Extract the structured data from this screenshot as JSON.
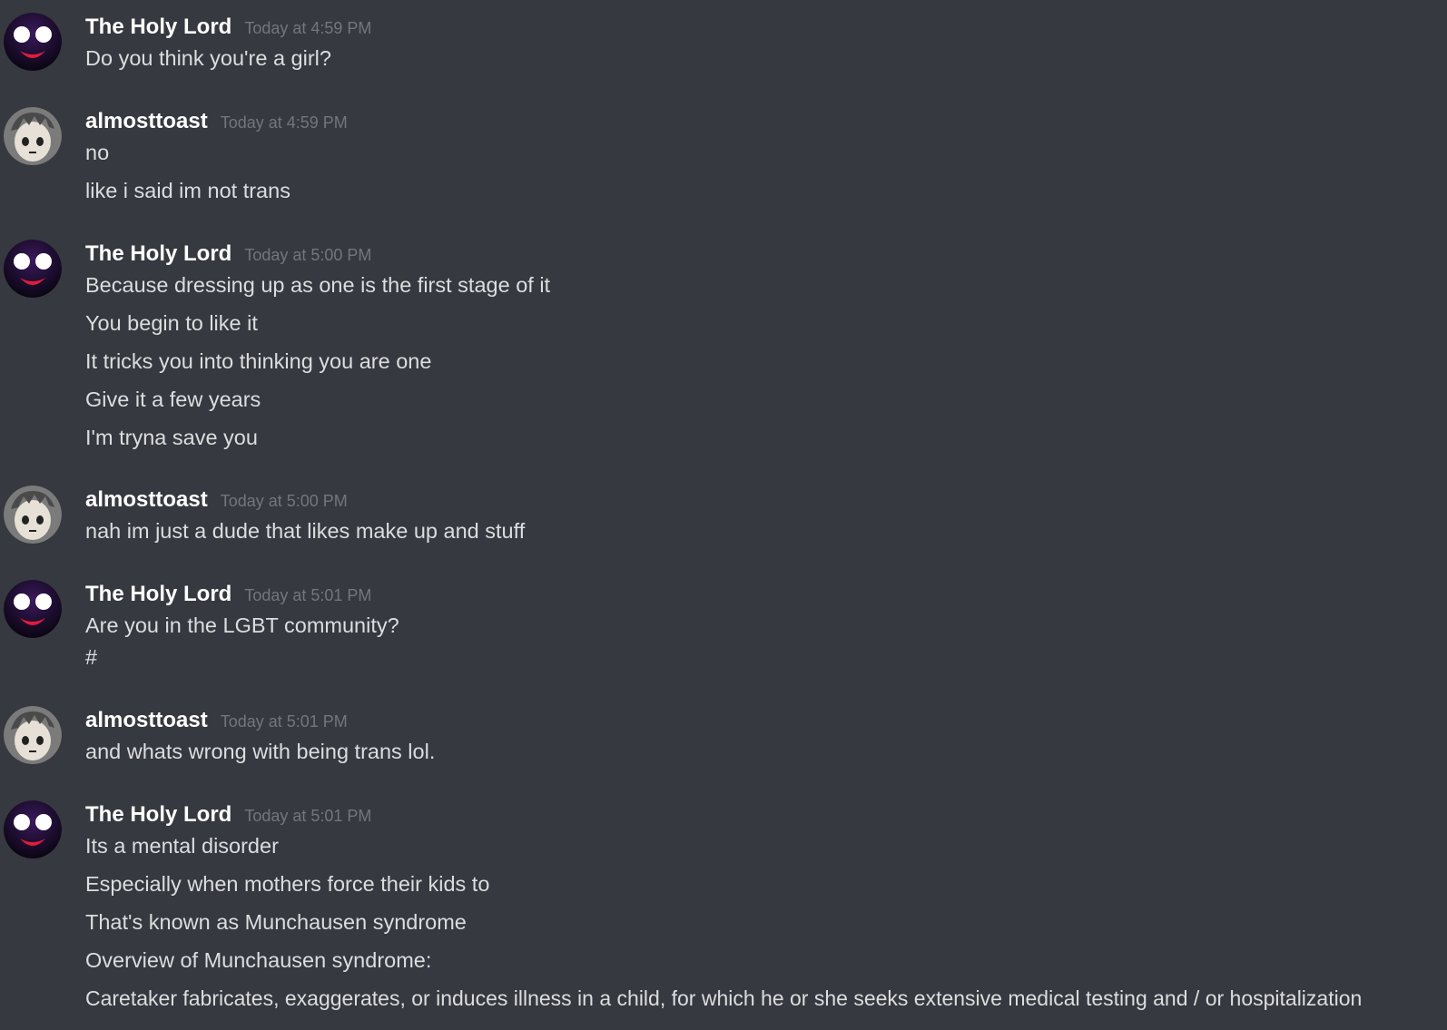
{
  "messages": [
    {
      "author": "The Holy Lord",
      "avatar": "purple-smiley-face",
      "timestamp": "Today at 4:59 PM",
      "lines": [
        "Do you think you're a girl?"
      ]
    },
    {
      "author": "almosttoast",
      "avatar": "face-sketch",
      "timestamp": "Today at 4:59 PM",
      "lines": [
        "no",
        "like i said im not trans"
      ]
    },
    {
      "author": "The Holy Lord",
      "avatar": "purple-smiley-face",
      "timestamp": "Today at 5:00 PM",
      "lines": [
        "Because dressing up as one is the first stage of it",
        "You begin to like it",
        "It tricks you into thinking you are one",
        "Give it a few years",
        "I'm tryna save you"
      ]
    },
    {
      "author": "almosttoast",
      "avatar": "face-sketch",
      "timestamp": "Today at 5:00 PM",
      "lines": [
        "nah im just a dude that likes make up and stuff"
      ]
    },
    {
      "author": "The Holy Lord",
      "avatar": "purple-smiley-face",
      "timestamp": "Today at 5:01 PM",
      "lines": [
        "Are you in the LGBT community?",
        "#"
      ]
    },
    {
      "author": "almosttoast",
      "avatar": "face-sketch",
      "timestamp": "Today at 5:01 PM",
      "lines": [
        "and whats wrong with being trans lol."
      ]
    },
    {
      "author": "The Holy Lord",
      "avatar": "purple-smiley-face",
      "timestamp": "Today at 5:01 PM",
      "lines": [
        "Its a mental disorder",
        "Especially when mothers force their kids to",
        "That's known as Munchausen syndrome",
        "Overview of Munchausen syndrome:",
        "Caretaker fabricates, exaggerates, or induces illness in a child, for which he or she seeks extensive medical testing and / or hospitalization"
      ]
    }
  ]
}
